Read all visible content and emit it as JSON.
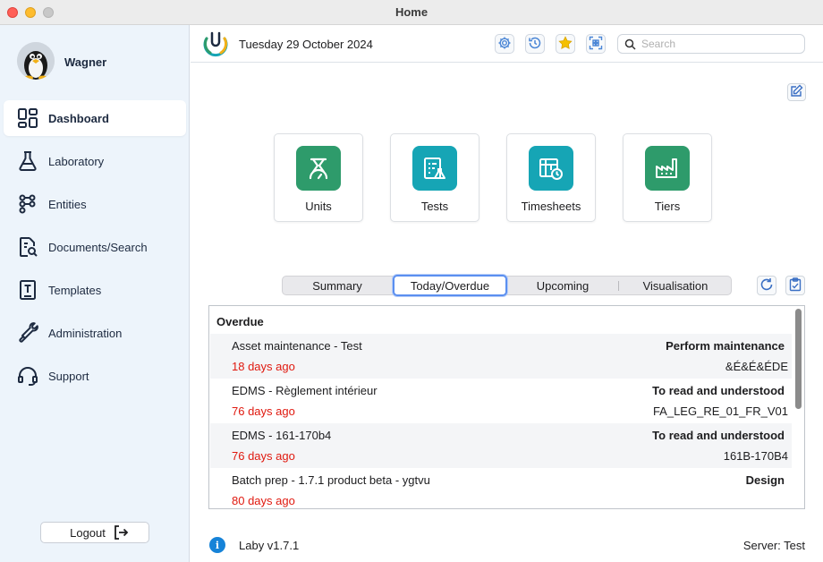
{
  "window": {
    "title": "Home"
  },
  "user": {
    "name": "Wagner"
  },
  "sidebar": {
    "items": [
      {
        "label": "Dashboard",
        "icon": "dashboard-icon",
        "active": true
      },
      {
        "label": "Laboratory",
        "icon": "flask-icon"
      },
      {
        "label": "Entities",
        "icon": "entities-icon"
      },
      {
        "label": "Documents/Search",
        "icon": "document-search-icon"
      },
      {
        "label": "Templates",
        "icon": "template-icon"
      },
      {
        "label": "Administration",
        "icon": "wrench-icon"
      },
      {
        "label": "Support",
        "icon": "headset-icon"
      }
    ],
    "logout_label": "Logout"
  },
  "header": {
    "date": "Tuesday 29 October 2024",
    "search_placeholder": "Search"
  },
  "tiles": [
    {
      "label": "Units",
      "color": "#2e9b6b"
    },
    {
      "label": "Tests",
      "color": "#16a5b5"
    },
    {
      "label": "Timesheets",
      "color": "#16a5b5"
    },
    {
      "label": "Tiers",
      "color": "#2e9b6b"
    }
  ],
  "tabs": [
    "Summary",
    "Today/Overdue",
    "Upcoming",
    "Visualisation"
  ],
  "active_tab": "Today/Overdue",
  "list": {
    "section": "Overdue",
    "rows": [
      {
        "title": "Asset maintenance - Test",
        "due": "18 days ago",
        "action": "Perform maintenance",
        "ref": "&É&É&ÉDE"
      },
      {
        "title": "EDMS - Règlement intérieur",
        "due": "76 days ago",
        "action": "To read and understood",
        "ref": "FA_LEG_RE_01_FR_V01"
      },
      {
        "title": "EDMS - 161-170b4",
        "due": "76 days ago",
        "action": "To read and understood",
        "ref": "161B-170B4"
      },
      {
        "title": "Batch prep - 1.7.1 product beta - ygtvu",
        "due": "80 days ago",
        "action": "Design",
        "ref": ""
      }
    ]
  },
  "footer": {
    "version": "Laby v1.7.1",
    "server": "Server: Test"
  },
  "colors": {
    "accent": "#1d2a40",
    "overdue": "#e0190f",
    "tile_green": "#2e9b6b",
    "tile_teal": "#16a5b5"
  }
}
